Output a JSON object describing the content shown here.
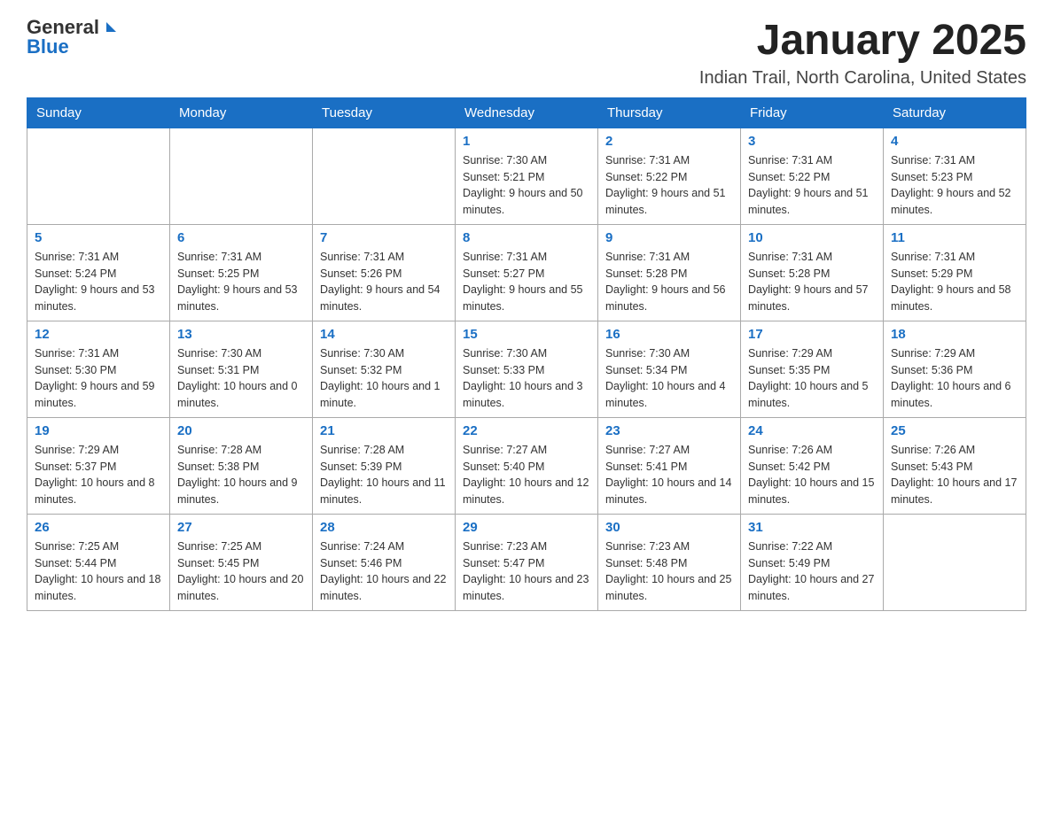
{
  "logo": {
    "general": "General",
    "blue": "Blue"
  },
  "title": "January 2025",
  "subtitle": "Indian Trail, North Carolina, United States",
  "days_of_week": [
    "Sunday",
    "Monday",
    "Tuesday",
    "Wednesday",
    "Thursday",
    "Friday",
    "Saturday"
  ],
  "weeks": [
    [
      {
        "day": "",
        "info": ""
      },
      {
        "day": "",
        "info": ""
      },
      {
        "day": "",
        "info": ""
      },
      {
        "day": "1",
        "info": "Sunrise: 7:30 AM\nSunset: 5:21 PM\nDaylight: 9 hours and 50 minutes."
      },
      {
        "day": "2",
        "info": "Sunrise: 7:31 AM\nSunset: 5:22 PM\nDaylight: 9 hours and 51 minutes."
      },
      {
        "day": "3",
        "info": "Sunrise: 7:31 AM\nSunset: 5:22 PM\nDaylight: 9 hours and 51 minutes."
      },
      {
        "day": "4",
        "info": "Sunrise: 7:31 AM\nSunset: 5:23 PM\nDaylight: 9 hours and 52 minutes."
      }
    ],
    [
      {
        "day": "5",
        "info": "Sunrise: 7:31 AM\nSunset: 5:24 PM\nDaylight: 9 hours and 53 minutes."
      },
      {
        "day": "6",
        "info": "Sunrise: 7:31 AM\nSunset: 5:25 PM\nDaylight: 9 hours and 53 minutes."
      },
      {
        "day": "7",
        "info": "Sunrise: 7:31 AM\nSunset: 5:26 PM\nDaylight: 9 hours and 54 minutes."
      },
      {
        "day": "8",
        "info": "Sunrise: 7:31 AM\nSunset: 5:27 PM\nDaylight: 9 hours and 55 minutes."
      },
      {
        "day": "9",
        "info": "Sunrise: 7:31 AM\nSunset: 5:28 PM\nDaylight: 9 hours and 56 minutes."
      },
      {
        "day": "10",
        "info": "Sunrise: 7:31 AM\nSunset: 5:28 PM\nDaylight: 9 hours and 57 minutes."
      },
      {
        "day": "11",
        "info": "Sunrise: 7:31 AM\nSunset: 5:29 PM\nDaylight: 9 hours and 58 minutes."
      }
    ],
    [
      {
        "day": "12",
        "info": "Sunrise: 7:31 AM\nSunset: 5:30 PM\nDaylight: 9 hours and 59 minutes."
      },
      {
        "day": "13",
        "info": "Sunrise: 7:30 AM\nSunset: 5:31 PM\nDaylight: 10 hours and 0 minutes."
      },
      {
        "day": "14",
        "info": "Sunrise: 7:30 AM\nSunset: 5:32 PM\nDaylight: 10 hours and 1 minute."
      },
      {
        "day": "15",
        "info": "Sunrise: 7:30 AM\nSunset: 5:33 PM\nDaylight: 10 hours and 3 minutes."
      },
      {
        "day": "16",
        "info": "Sunrise: 7:30 AM\nSunset: 5:34 PM\nDaylight: 10 hours and 4 minutes."
      },
      {
        "day": "17",
        "info": "Sunrise: 7:29 AM\nSunset: 5:35 PM\nDaylight: 10 hours and 5 minutes."
      },
      {
        "day": "18",
        "info": "Sunrise: 7:29 AM\nSunset: 5:36 PM\nDaylight: 10 hours and 6 minutes."
      }
    ],
    [
      {
        "day": "19",
        "info": "Sunrise: 7:29 AM\nSunset: 5:37 PM\nDaylight: 10 hours and 8 minutes."
      },
      {
        "day": "20",
        "info": "Sunrise: 7:28 AM\nSunset: 5:38 PM\nDaylight: 10 hours and 9 minutes."
      },
      {
        "day": "21",
        "info": "Sunrise: 7:28 AM\nSunset: 5:39 PM\nDaylight: 10 hours and 11 minutes."
      },
      {
        "day": "22",
        "info": "Sunrise: 7:27 AM\nSunset: 5:40 PM\nDaylight: 10 hours and 12 minutes."
      },
      {
        "day": "23",
        "info": "Sunrise: 7:27 AM\nSunset: 5:41 PM\nDaylight: 10 hours and 14 minutes."
      },
      {
        "day": "24",
        "info": "Sunrise: 7:26 AM\nSunset: 5:42 PM\nDaylight: 10 hours and 15 minutes."
      },
      {
        "day": "25",
        "info": "Sunrise: 7:26 AM\nSunset: 5:43 PM\nDaylight: 10 hours and 17 minutes."
      }
    ],
    [
      {
        "day": "26",
        "info": "Sunrise: 7:25 AM\nSunset: 5:44 PM\nDaylight: 10 hours and 18 minutes."
      },
      {
        "day": "27",
        "info": "Sunrise: 7:25 AM\nSunset: 5:45 PM\nDaylight: 10 hours and 20 minutes."
      },
      {
        "day": "28",
        "info": "Sunrise: 7:24 AM\nSunset: 5:46 PM\nDaylight: 10 hours and 22 minutes."
      },
      {
        "day": "29",
        "info": "Sunrise: 7:23 AM\nSunset: 5:47 PM\nDaylight: 10 hours and 23 minutes."
      },
      {
        "day": "30",
        "info": "Sunrise: 7:23 AM\nSunset: 5:48 PM\nDaylight: 10 hours and 25 minutes."
      },
      {
        "day": "31",
        "info": "Sunrise: 7:22 AM\nSunset: 5:49 PM\nDaylight: 10 hours and 27 minutes."
      },
      {
        "day": "",
        "info": ""
      }
    ]
  ]
}
